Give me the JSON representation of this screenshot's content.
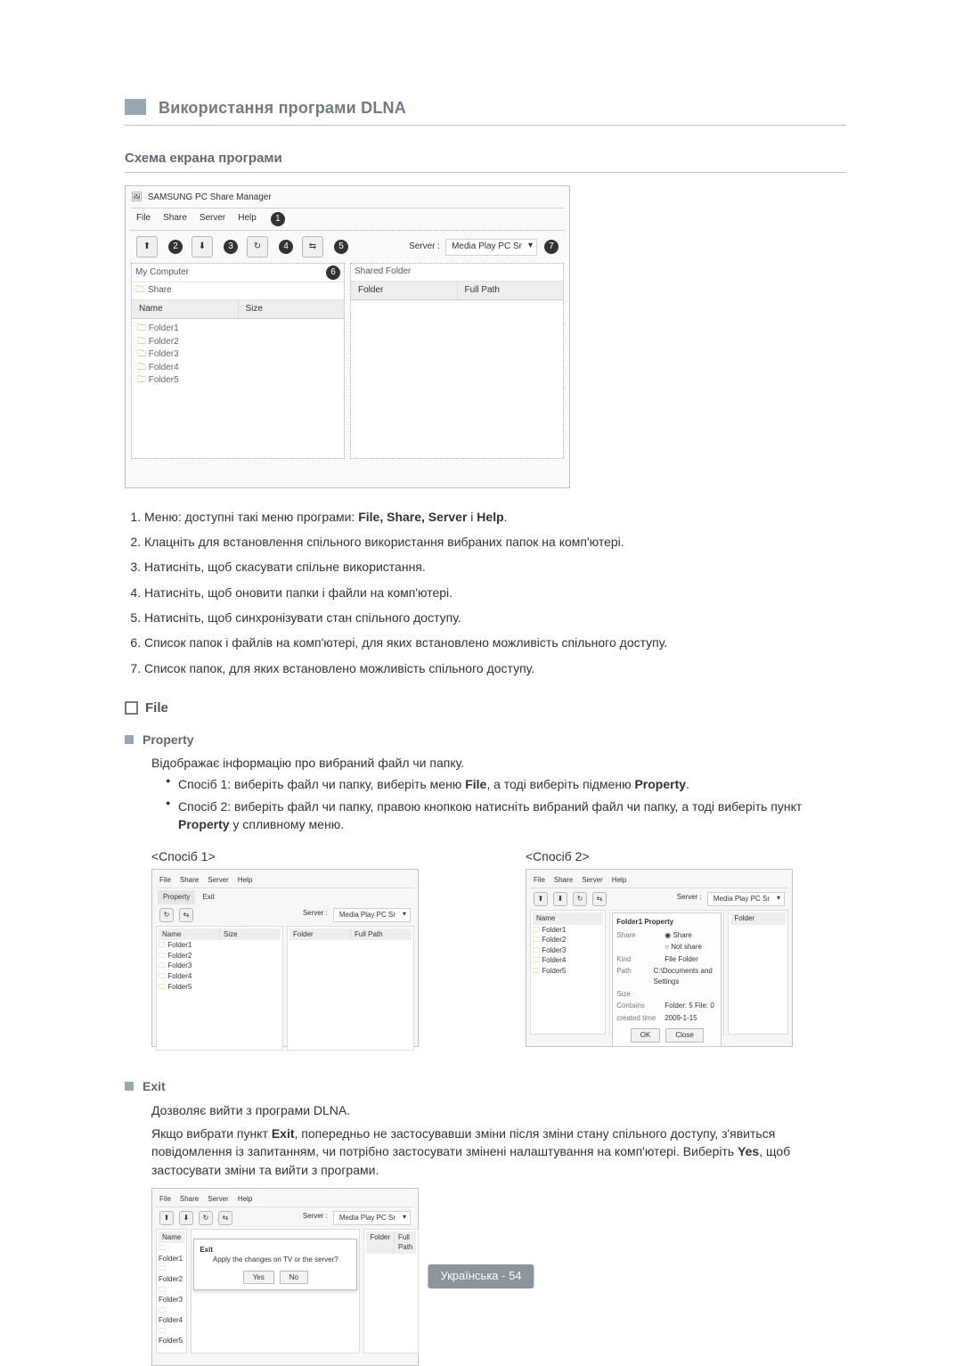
{
  "header": {
    "title": "Використання програми DLNA",
    "subtitle": "Схема екрана програми"
  },
  "shot": {
    "app_title": "SAMSUNG PC Share Manager",
    "menus": {
      "file": "File",
      "share": "Share",
      "server": "Server",
      "help": "Help"
    },
    "marks": [
      "1",
      "2",
      "3",
      "4",
      "5",
      "6",
      "7"
    ],
    "server_label": "Server :",
    "server_value": "Media Play PC Sr",
    "left_label": "My Computer",
    "left_share": "Share",
    "left_cols": {
      "name": "Name",
      "size": "Size"
    },
    "folders": [
      "Folder1",
      "Folder2",
      "Folder3",
      "Folder4",
      "Folder5"
    ],
    "right_label": "Shared Folder",
    "right_cols": {
      "folder": "Folder",
      "full_path": "Full Path"
    }
  },
  "list": [
    {
      "pre": "Меню: доступні такі меню програми: ",
      "bold": "File, Share, Server",
      "mid": " і ",
      "bold2": "Help",
      "post": "."
    },
    {
      "text": "Клацніть для встановлення спільного використання вибраних папок на комп'ютері."
    },
    {
      "text": "Натисніть, щоб скасувати спільне використання."
    },
    {
      "text": "Натисніть, щоб оновити папки і файли на комп'ютері."
    },
    {
      "text": "Натисніть, щоб синхронізувати стан спільного доступу."
    },
    {
      "text": "Список папок і файлів на комп'ютері, для яких встановлено можливість спільного доступу."
    },
    {
      "text": "Список папок, для яких встановлено можливість спільного доступу."
    }
  ],
  "file_heading": "File",
  "property": {
    "name": "Property",
    "desc": "Відображає інформацію про вибраний файл чи папку.",
    "m1": {
      "pre": "Спосіб 1: виберіть файл чи папку, виберіть меню ",
      "b1": "File",
      "mid": ", а тоді виберіть підменю ",
      "b2": "Property",
      "post": "."
    },
    "m2": {
      "pre": "Спосіб 2: виберіть файл чи папку, правою кнопкою натисніть вибраний файл чи папку, а тоді виберіть пункт ",
      "b1": "Property",
      "post": " у спливному меню."
    },
    "cap1": "<Спосіб 1>",
    "cap2": "<Спосіб 2>",
    "mini_server_value": "Media Play PC Sr",
    "sub_exit": "Exit",
    "prop_title": "Folder1 Property",
    "prop_rows": {
      "share_k": "Share",
      "share_v": "Share",
      "not_share": "Not share",
      "kind_k": "Kind",
      "kind_v": "File Folder",
      "path_k": "Path",
      "path_v": "C:\\Documents and Settings",
      "size_k": "Size",
      "contains_k": "Contains",
      "contains_v": "Folder: 5 File: 0",
      "created_k": "created time",
      "created_v": "2009-1-15"
    },
    "ok": "OK",
    "close": "Close"
  },
  "exit": {
    "name": "Exit",
    "line1": "Дозволяє вийти з програми DLNA.",
    "line2_pre": "Якщо вибрати пункт ",
    "line2_b1": "Exit",
    "line2_mid": ", попередньо не застосувавши зміни після зміни стану спільного доступу, з'явиться повідомлення із запитанням, чи потрібно застосувати змінені налаштування на комп'ютері. Виберіть ",
    "line2_b2": "Yes",
    "line2_post": ", щоб застосувати зміни та вийти з програми.",
    "dialog_title": "Exit",
    "dialog_text": "Apply the changes on TV or the server?",
    "yes": "Yes",
    "no": "No"
  },
  "footer": "Українська - 54"
}
